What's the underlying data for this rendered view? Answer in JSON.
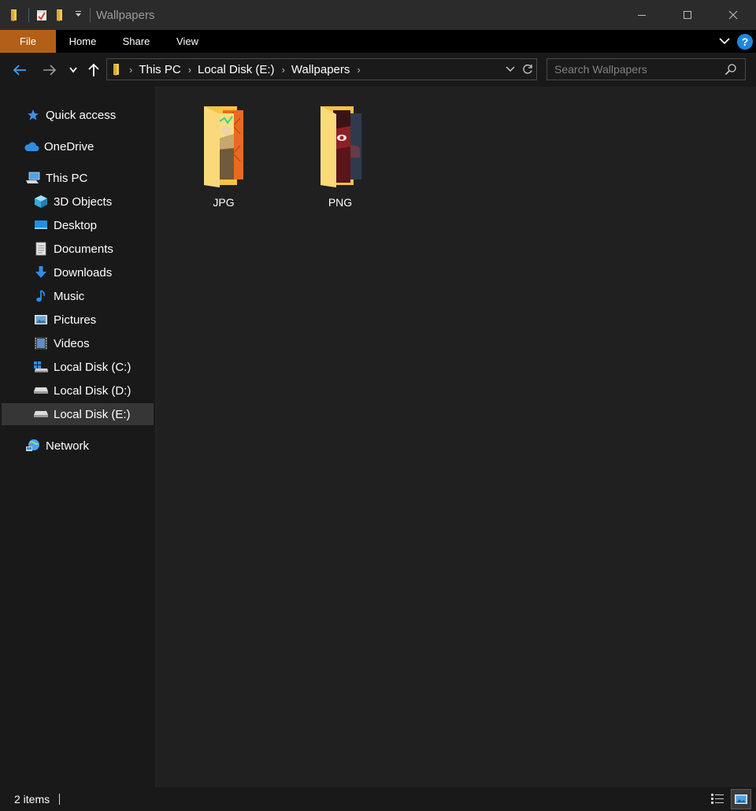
{
  "window": {
    "title": "Wallpapers",
    "controls": {
      "minimize": "minimize",
      "maximize": "maximize",
      "close": "close"
    }
  },
  "ribbon": {
    "tabs": [
      {
        "label": "File"
      },
      {
        "label": "Home"
      },
      {
        "label": "Share"
      },
      {
        "label": "View"
      }
    ],
    "help_label": "?"
  },
  "address": {
    "crumbs": [
      {
        "label": "This PC"
      },
      {
        "label": "Local Disk (E:)"
      },
      {
        "label": "Wallpapers"
      }
    ]
  },
  "search": {
    "placeholder": "Search Wallpapers"
  },
  "nav": {
    "items": [
      {
        "label": "Quick access",
        "icon": "star-icon"
      },
      {
        "label": "OneDrive",
        "icon": "cloud-icon"
      },
      {
        "label": "This PC",
        "icon": "computer-icon"
      },
      {
        "label": "3D Objects",
        "icon": "cube-icon"
      },
      {
        "label": "Desktop",
        "icon": "desktop-icon"
      },
      {
        "label": "Documents",
        "icon": "document-icon"
      },
      {
        "label": "Downloads",
        "icon": "download-icon"
      },
      {
        "label": "Music",
        "icon": "music-icon"
      },
      {
        "label": "Pictures",
        "icon": "pictures-icon"
      },
      {
        "label": "Videos",
        "icon": "video-icon"
      },
      {
        "label": "Local Disk (C:)",
        "icon": "windows-drive-icon"
      },
      {
        "label": "Local Disk (D:)",
        "icon": "drive-icon"
      },
      {
        "label": "Local Disk (E:)",
        "icon": "drive-icon",
        "selected": true
      },
      {
        "label": "Network",
        "icon": "network-icon"
      }
    ]
  },
  "content": {
    "folders": [
      {
        "label": "JPG",
        "icon": "folder-with-thumbnail-icon"
      },
      {
        "label": "PNG",
        "icon": "folder-with-thumbnail-icon"
      }
    ]
  },
  "status": {
    "item_count": "2 items"
  },
  "colors": {
    "accent_file_tab": "#b35f17",
    "help_blue": "#1f86dd",
    "selection": "#363636",
    "folder_yellow": "#f8d775"
  }
}
